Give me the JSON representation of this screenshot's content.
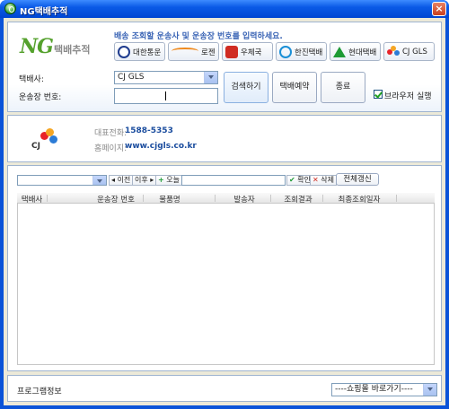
{
  "window": {
    "title": "NG택배추적",
    "close_glyph": "×"
  },
  "logo": {
    "mark": "NG",
    "subtitle": "택배추적"
  },
  "guide_text": "배송 조회할 운송사 및 운송장 번호를 입력하세요.",
  "carriers": [
    {
      "label": "대한통운",
      "icon": "korex-circle-icon"
    },
    {
      "label": "로젠",
      "icon": "logen-swoosh-icon"
    },
    {
      "label": "우체국",
      "icon": "korea-post-icon"
    },
    {
      "label": "한진택배",
      "icon": "hanjin-circle-icon"
    },
    {
      "label": "현대택배",
      "icon": "hyundai-triangle-icon"
    },
    {
      "label": "CJ GLS",
      "icon": "cj-petal-icon"
    }
  ],
  "form": {
    "carrier_label": "택배사:",
    "carrier_selected": "CJ GLS",
    "tracking_label": "운송장 번호:",
    "tracking_value": ""
  },
  "actions": {
    "search": "검색하기",
    "reserve": "택배예약",
    "exit": "종료",
    "browser_checkbox": "브라우저 실행",
    "browser_checked": true
  },
  "company": {
    "logo_text": "CJ",
    "phone_label": "대표전화:",
    "phone_value": "1588-5353",
    "homepage_label": "홈페이지:",
    "homepage_value": "www.cjgls.co.kr"
  },
  "history": {
    "prev": "이전",
    "next": "이후",
    "add": "오늘",
    "confirm": "확인",
    "delete": "삭제",
    "refresh_all": "전체갱신",
    "columns": [
      "택배사",
      "운송장 번호",
      "물품명",
      "발송자",
      "조회결과",
      "최종조회일자"
    ],
    "rows": []
  },
  "footer": {
    "program_info": "프로그램정보",
    "shortcut_selected": "----쇼핑몰 바로가기----"
  },
  "colors": {
    "titlebar": "#0a5ae6",
    "panel_border": "#9fb4cf",
    "accent_text": "#1a4c9e",
    "logo_green": "#55a12d"
  }
}
